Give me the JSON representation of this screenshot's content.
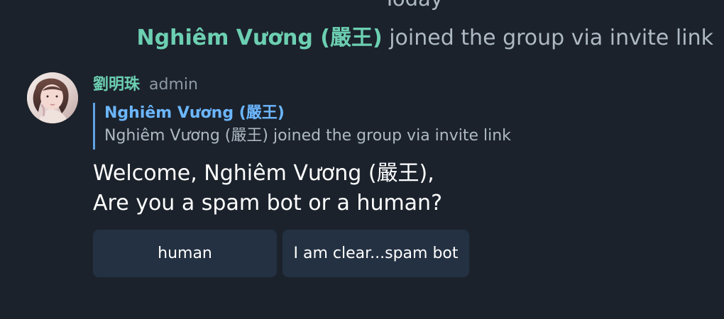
{
  "chat": {
    "date_label": "Today",
    "service_message": {
      "user": "Nghiêm Vương (嚴王)",
      "text": "joined the group via invite link"
    },
    "message": {
      "sender_name": "劉明珠",
      "sender_role": "admin",
      "reply_preview": {
        "name": "Nghiêm Vương (嚴王)",
        "text": "Nghiêm Vương (嚴王) joined the group via invite link"
      },
      "body_line_1": "Welcome, Nghiêm Vương (嚴王),",
      "body_line_2": "Are you a spam bot or a human?",
      "buttons": [
        {
          "label": "human"
        },
        {
          "label": "I am clear...spam bot"
        }
      ]
    }
  }
}
